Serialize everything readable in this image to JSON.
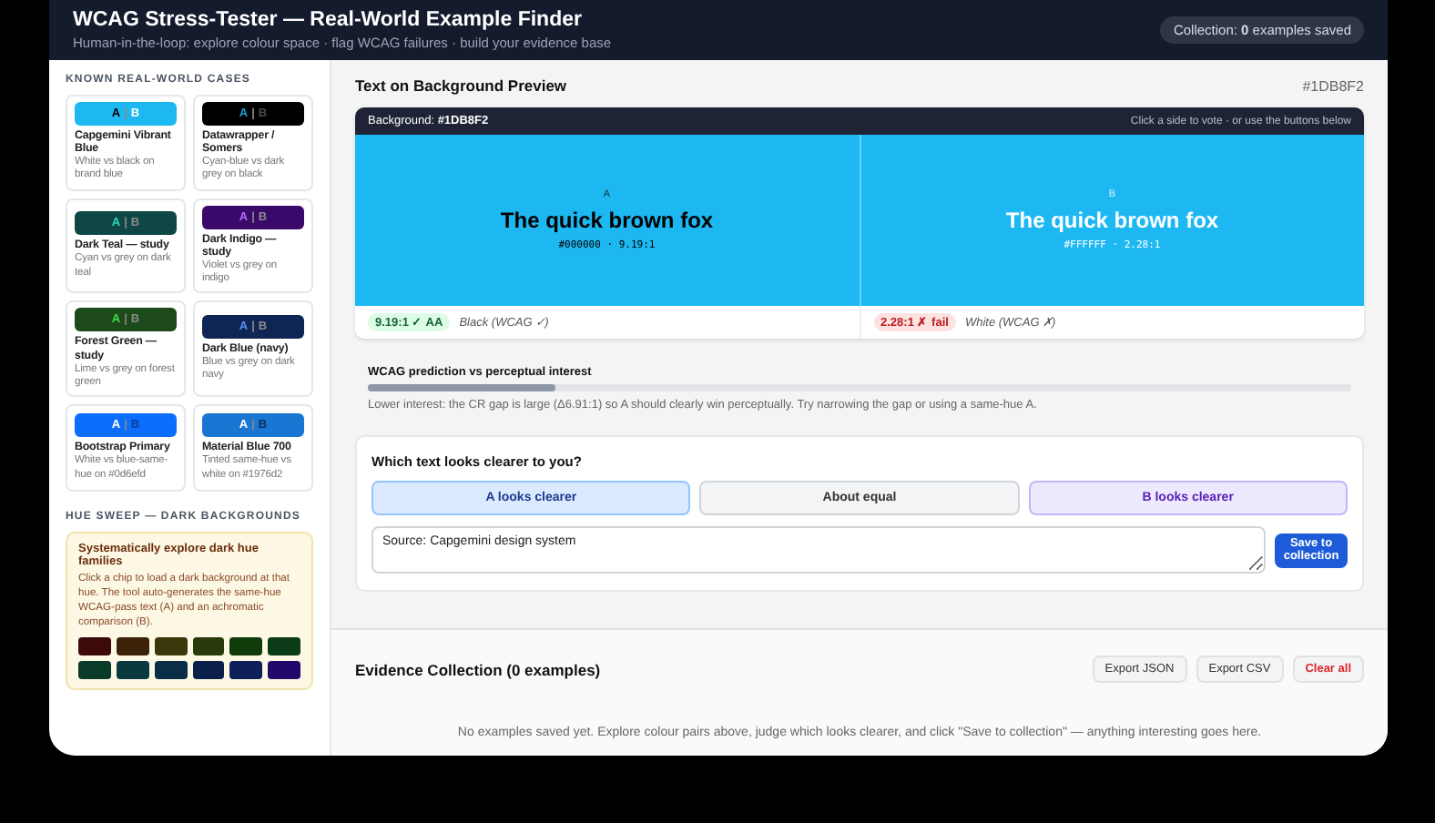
{
  "header": {
    "title": "WCAG Stress-Tester — Real-World Example Finder",
    "subtitle": "Human-in-the-loop: explore colour space · flag WCAG failures · build your evidence base",
    "collection_badge": "Collection: **0** examples saved"
  },
  "sidebar": {
    "cases_title": "KNOWN REAL-WORLD CASES",
    "cases": [
      {
        "name": "Capgemini Vibrant Blue",
        "description": "White vs black on brand blue",
        "swatch": [
          {
            "text": "A",
            "color": "#000000"
          },
          {
            "text": "|",
            "color": "#888888"
          },
          {
            "text": "B",
            "color": "#ffffff"
          }
        ],
        "color": "#1db8f2"
      },
      {
        "name": "Datawrapper / Somers",
        "description": "Cyan-blue vs dark grey on black",
        "swatch": [
          {
            "text": "A",
            "color": "#1a9fd6"
          },
          {
            "text": "|",
            "color": "#888888"
          },
          {
            "text": "B",
            "color": "#4a4a4a"
          }
        ],
        "color": "#000000"
      },
      {
        "name": "Dark Teal — study",
        "description": "Cyan vs grey on dark teal",
        "swatch": [
          {
            "text": "A",
            "color": "#2dd4bf"
          },
          {
            "text": "|",
            "color": "#888888"
          },
          {
            "text": "B",
            "color": "#8a8a8a"
          }
        ],
        "color": "#0f4747"
      },
      {
        "name": "Dark Indigo — study",
        "description": "Violet vs grey on indigo",
        "swatch": [
          {
            "text": "A",
            "color": "#b26df5"
          },
          {
            "text": "|",
            "color": "#888888"
          },
          {
            "text": "B",
            "color": "#8a8a8a"
          }
        ],
        "color": "#3a0a6a"
      },
      {
        "name": "Forest Green — study",
        "description": "Lime vs grey on forest green",
        "swatch": [
          {
            "text": "A",
            "color": "#3fd94a"
          },
          {
            "text": "|",
            "color": "#888888"
          },
          {
            "text": "B",
            "color": "#8a8a8a"
          }
        ],
        "color": "#1d4a1a"
      },
      {
        "name": "Dark Blue (navy)",
        "description": "Blue vs grey on dark navy",
        "swatch": [
          {
            "text": "A",
            "color": "#5b8ef0"
          },
          {
            "text": "|",
            "color": "#888888"
          },
          {
            "text": "B",
            "color": "#8a8a8a"
          }
        ],
        "color": "#0f2654"
      },
      {
        "name": "Bootstrap Primary",
        "description": "White vs blue-same-hue on #0d6efd",
        "swatch": [
          {
            "text": "A",
            "color": "#ffffff"
          },
          {
            "text": "|",
            "color": "#888888"
          },
          {
            "text": "B",
            "color": "#0a3f9a"
          }
        ],
        "color": "#0d6efd"
      },
      {
        "name": "Material Blue 700",
        "description": "Tinted same-hue vs white on #1976d2",
        "swatch": [
          {
            "text": "A",
            "color": "#ffffff"
          },
          {
            "text": "|",
            "color": "#888888"
          },
          {
            "text": "B",
            "color": "#0b2f5e"
          }
        ],
        "color": "#1976d2"
      }
    ],
    "hue_title": "HUE SWEEP — DARK BACKGROUNDS",
    "hue_box": {
      "title": "Systematically explore dark hue families",
      "text": "Click a chip to load a dark background at that hue. The tool auto-generates the same-hue WCAG-pass text (A) and an achromatic comparison (B).",
      "chips": [
        {
          "color": "#3d0a0c"
        },
        {
          "color": "#3d220a"
        },
        {
          "color": "#3a380a"
        },
        {
          "color": "#283a0a"
        },
        {
          "color": "#0f3a0a"
        },
        {
          "color": "#0a3a16"
        },
        {
          "color": "#0a3a28"
        },
        {
          "color": "#0a3a40"
        },
        {
          "color": "#0a2e48"
        },
        {
          "color": "#0a1f4a"
        },
        {
          "color": "#0f1f5a"
        },
        {
          "color": "#22086a"
        }
      ]
    }
  },
  "preview": {
    "title": "Text on Background Preview",
    "hex": "#1DB8F2",
    "color": "#1db8f2",
    "bar_label": "Background: **#1DB8F2**",
    "bar_hint": "Click a side to vote · or use the buttons below",
    "sides": [
      {
        "label": "A",
        "sample": "The quick brown fox",
        "meta": "#000000 · 9.19:1",
        "color": "#000000",
        "verdict": {
          "kind": "pass",
          "text": "9.19:1 ✓ AA"
        },
        "note": "Black (WCAG ✓)"
      },
      {
        "label": "B",
        "sample": "The quick brown fox",
        "meta": "#FFFFFF · 2.28:1",
        "color": "#ffffff",
        "verdict": {
          "kind": "fail",
          "text": "2.28:1 ✗ fail"
        },
        "note": "White (WCAG ✗)"
      }
    ]
  },
  "interest": {
    "title": "WCAG prediction vs perceptual interest",
    "level": 0.19,
    "text": "Lower interest: the CR gap is large (Δ6.91:1) so A should clearly win perceptually. Try narrowing the gap or using a same-hue A."
  },
  "vote": {
    "question": "Which text looks clearer to you?",
    "options": [
      {
        "kind": "a",
        "label": "A looks clearer"
      },
      {
        "kind": "equal",
        "label": "About equal"
      },
      {
        "kind": "b",
        "label": "B looks clearer"
      }
    ],
    "note_value": "Source: Capgemini design system",
    "save": "Save to collection"
  },
  "evidence": {
    "title": "Evidence Collection (0 examples)",
    "buttons": [
      {
        "kind": "plain",
        "label": "Export JSON"
      },
      {
        "kind": "plain",
        "label": "Export CSV"
      },
      {
        "kind": "danger",
        "label": "Clear all"
      }
    ],
    "empty": "No examples saved yet. Explore colour pairs above, judge which looks clearer, and click \"Save to collection\" — anything interesting goes here."
  }
}
